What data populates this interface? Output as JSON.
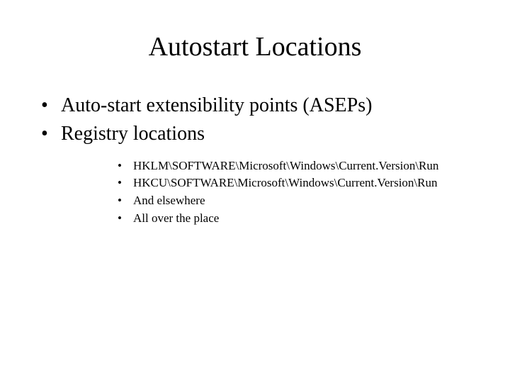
{
  "title": "Autostart Locations",
  "bullets": {
    "b0": "Auto-start extensibility points (ASEPs)",
    "b1": "Registry locations"
  },
  "sub_bullets": {
    "s0": "HKLM\\SOFTWARE\\Microsoft\\Windows\\Current.Version\\Run",
    "s1": "HKCU\\SOFTWARE\\Microsoft\\Windows\\Current.Version\\Run",
    "s2": "And elsewhere",
    "s3": "All over the place"
  }
}
